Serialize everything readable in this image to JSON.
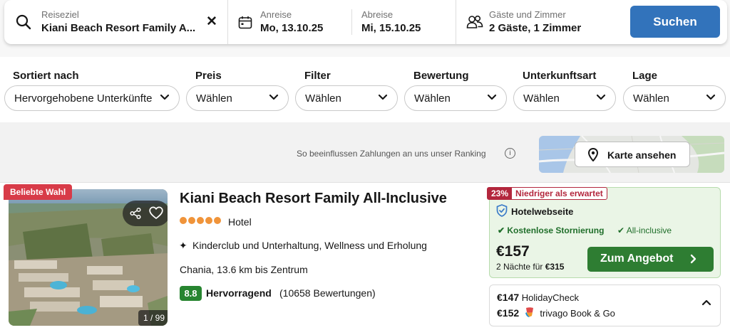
{
  "search": {
    "destination_label": "Reiseziel",
    "destination_value": "Kiani Beach Resort Family A...",
    "checkin_label": "Anreise",
    "checkin_value": "Mo, 13.10.25",
    "checkout_label": "Abreise",
    "checkout_value": "Mi, 15.10.25",
    "guests_label": "Gäste und Zimmer",
    "guests_value": "2 Gäste, 1 Zimmer",
    "clear_symbol": "✕",
    "search_button": "Suchen"
  },
  "filters": [
    {
      "label": "Sortiert nach",
      "value": "Hervorgehobene Unterkünfte"
    },
    {
      "label": "Preis",
      "value": "Wählen"
    },
    {
      "label": "Filter",
      "value": "Wählen"
    },
    {
      "label": "Bewertung",
      "value": "Wählen"
    },
    {
      "label": "Unterkunftsart",
      "value": "Wählen"
    },
    {
      "label": "Lage",
      "value": "Wählen"
    }
  ],
  "ranking_note": "So beeinflussen Zahlungen an uns unser Ranking",
  "info_symbol": "i",
  "map_button": "Karte ansehen",
  "result": {
    "badge": "Beliebte Wahl",
    "photo_counter": "1 / 99",
    "name": "Kiani Beach Resort Family All-Inclusive",
    "stars": 5,
    "type": "Hotel",
    "amenities_icon": "✦",
    "amenities": "Kinderclub und Unterhaltung, Wellness und Erholung",
    "location": "Chania, 13.6 km bis Zentrum",
    "rating_score": "8.8",
    "rating_word": "Hervorragend",
    "rating_count": "(10658 Bewertungen)",
    "deal": {
      "discount_percent": "23%",
      "discount_text": "Niedriger als erwartet",
      "provider": "Hotelwebseite",
      "feature_1": "✔ Kostenlose Stornierung",
      "feature_2": "✔ All-inclusive",
      "price": "€157",
      "nights_text": "2 Nächte für",
      "nights_total": "€315",
      "button": "Zum Angebot"
    },
    "other_offers": [
      {
        "price": "€147",
        "provider": "HolidayCheck"
      },
      {
        "price": "€152",
        "provider": "trivago Book & Go"
      }
    ]
  },
  "colors": {
    "primary_blue": "#3273bb",
    "deal_green": "#2e7d32",
    "rating_green": "#278530",
    "popular_red": "#d83b48",
    "discount_red": "#b3273d",
    "star_orange": "#f0943a"
  },
  "icons": [
    "search-icon",
    "calendar-icon",
    "guests-icon",
    "map-pin-icon",
    "info-icon",
    "share-icon",
    "heart-icon",
    "sparkle-icon",
    "shield-check-icon",
    "chevron-right-icon",
    "chevron-down-icon",
    "chevron-up-icon"
  ]
}
